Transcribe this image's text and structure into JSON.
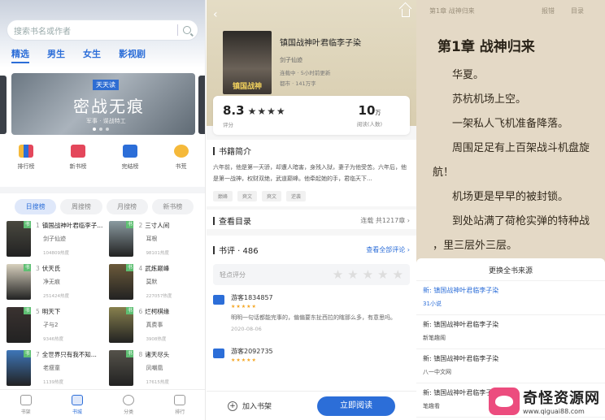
{
  "home": {
    "search_placeholder": "搜索书名或作者",
    "categories": [
      "精选",
      "男生",
      "女生",
      "影视剧"
    ],
    "banner": {
      "tag": "天天读",
      "title": "密战无痕",
      "subtitle": "军事 · 谍战特工"
    },
    "quick": [
      "排行榜",
      "新书榜",
      "完结榜",
      "书荒"
    ],
    "rank_tabs": [
      "日搜榜",
      "周搜榜",
      "月搜榜",
      "新书榜"
    ],
    "books": [
      {
        "rank": "1",
        "title": "镇国战神叶君临李子...",
        "author": "剑子仙迹",
        "heat": "104809热度",
        "color": "#49483f"
      },
      {
        "rank": "2",
        "title": "三寸人间",
        "author": "耳根",
        "heat": "98101热度",
        "color": "#8a9aa0"
      },
      {
        "rank": "3",
        "title": "伏天氏",
        "author": "净无痕",
        "heat": "251424热度",
        "color": "#d7d0bd"
      },
      {
        "rank": "4",
        "title": "武炼巅峰",
        "author": "莫默",
        "heat": "227057热度",
        "color": "#6b5a3a"
      },
      {
        "rank": "5",
        "title": "明天下",
        "author": "孑与2",
        "heat": "9346热度",
        "color": "#3a3230"
      },
      {
        "rank": "6",
        "title": "烂柯棋缘",
        "author": "真费事",
        "heat": "3908热度",
        "color": "#87804e"
      },
      {
        "rank": "7",
        "title": "全世界只有我不知...",
        "author": "老瘦童",
        "heat": "1139热度",
        "color": "#3e76b8"
      },
      {
        "rank": "8",
        "title": "诸天尽头",
        "author": "凤嘲凰",
        "heat": "17615热度",
        "color": "#55524a"
      }
    ],
    "tabbar": [
      "书架",
      "书城",
      "分类",
      "排行"
    ]
  },
  "detail": {
    "cover_text": "镇国战神",
    "title": "镇国战神叶君临李子染",
    "author": "剑子仙迹",
    "status": "连载中 · 5小时前更新",
    "category": "都市 · 141万字",
    "score": "8.3",
    "stars": "★★★★",
    "score_label": "评分",
    "reads": "10",
    "reads_unit": "万",
    "reads_label": "阅读(人数)",
    "intro_title": "书籍简介",
    "intro": "六年前，他是第一天骄，却遭人暗害，身残入狱，妻子为他受苦。六年后，他是第一战神，权财双绝，武道巅峰。他牵起她的手，君临天下...",
    "tags": [
      "巅峰",
      "爽文",
      "爽文",
      "逆袭"
    ],
    "catalog_title": "查看目录",
    "catalog_status": "连载 共1217章 ›",
    "review_title": "书评 · 486",
    "review_all": "查看全部评论 ›",
    "rate_label": "轻点评分",
    "comments": [
      {
        "user": "游客1834857",
        "stars": "★★★★★",
        "text": "明明一句话都能完事的，偏偏要东扯西拉的瞎那么多，有意思吗。",
        "date": "2020-08-06"
      },
      {
        "user": "游客2092735",
        "stars": "★★★★★",
        "text": "",
        "date": ""
      }
    ],
    "add_shelf": "加入书架",
    "read_now": "立即阅读"
  },
  "reader": {
    "chapter_head": "第1章 战神归来",
    "btn1": "报错",
    "btn2": "目录",
    "chapter_title": "第1章 战神归来",
    "lines": [
      "华夏。",
      "苏杭机场上空。",
      "一架私人飞机准备降落。",
      "周围足足有上百架战斗机盘旋",
      "航！",
      "机场更是早早的被封锁。",
      "到处站满了荷枪实弹的特种战",
      "，里三层外三层。"
    ],
    "sheet_title": "更换全书来源",
    "sources": [
      {
        "name": "新: 镇国战神叶君临李子染",
        "site": "31小说",
        "current": true
      },
      {
        "name": "新: 镇国战神叶君临李子染",
        "site": "新笔趣阁",
        "current": false
      },
      {
        "name": "新: 镇国战神叶君临李子染",
        "site": "八一中文网",
        "current": false
      },
      {
        "name": "新: 镇国战神叶君临李子染",
        "site": "笔趣看",
        "current": false
      }
    ]
  },
  "watermark": {
    "name": "奇怪资源网",
    "url": "www.qiguai88.com"
  }
}
